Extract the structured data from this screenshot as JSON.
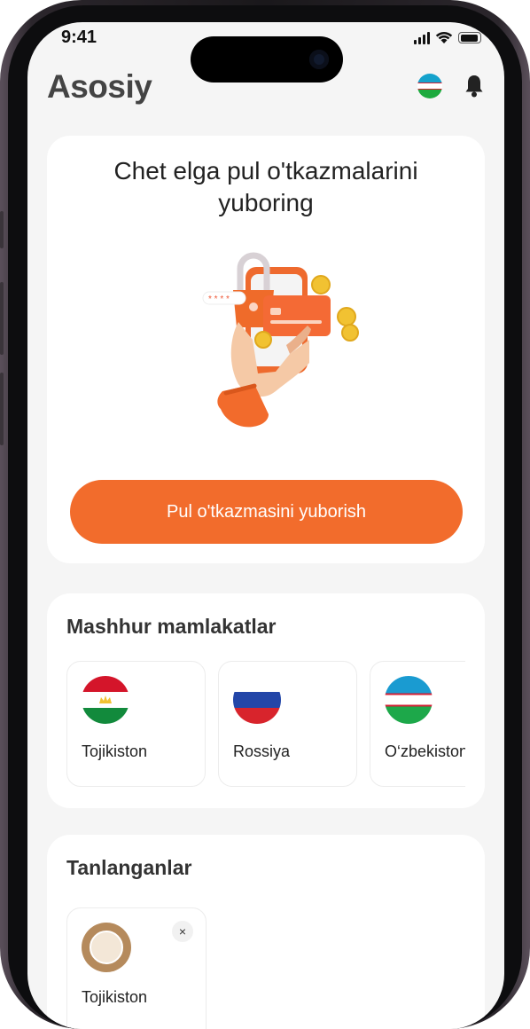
{
  "status_bar": {
    "time": "9:41"
  },
  "header": {
    "title": "Asosiy",
    "language_flag_icon": "uzbekistan-flag-icon",
    "notification_icon": "bell-icon"
  },
  "hero": {
    "title": "Chet elga pul o'tkazmalarini yuboring",
    "button_label": "Pul o'tkazmasini yuborish"
  },
  "popular": {
    "title": "Mashhur mamlakatlar",
    "countries": [
      {
        "name": "Tojikiston",
        "flag": "tajikistan-flag-icon"
      },
      {
        "name": "Rossiya",
        "flag": "russia-flag-icon"
      },
      {
        "name": "O‘zbekiston",
        "flag": "uzbekistan-flag-icon"
      }
    ]
  },
  "favorites": {
    "title": "Tanlanganlar",
    "items": [
      {
        "name": "Tojikiston",
        "icon": "tajikistan-emblem-icon",
        "remove_label": "×"
      }
    ]
  },
  "colors": {
    "accent": "#f26c2c",
    "background": "#f5f5f5"
  }
}
